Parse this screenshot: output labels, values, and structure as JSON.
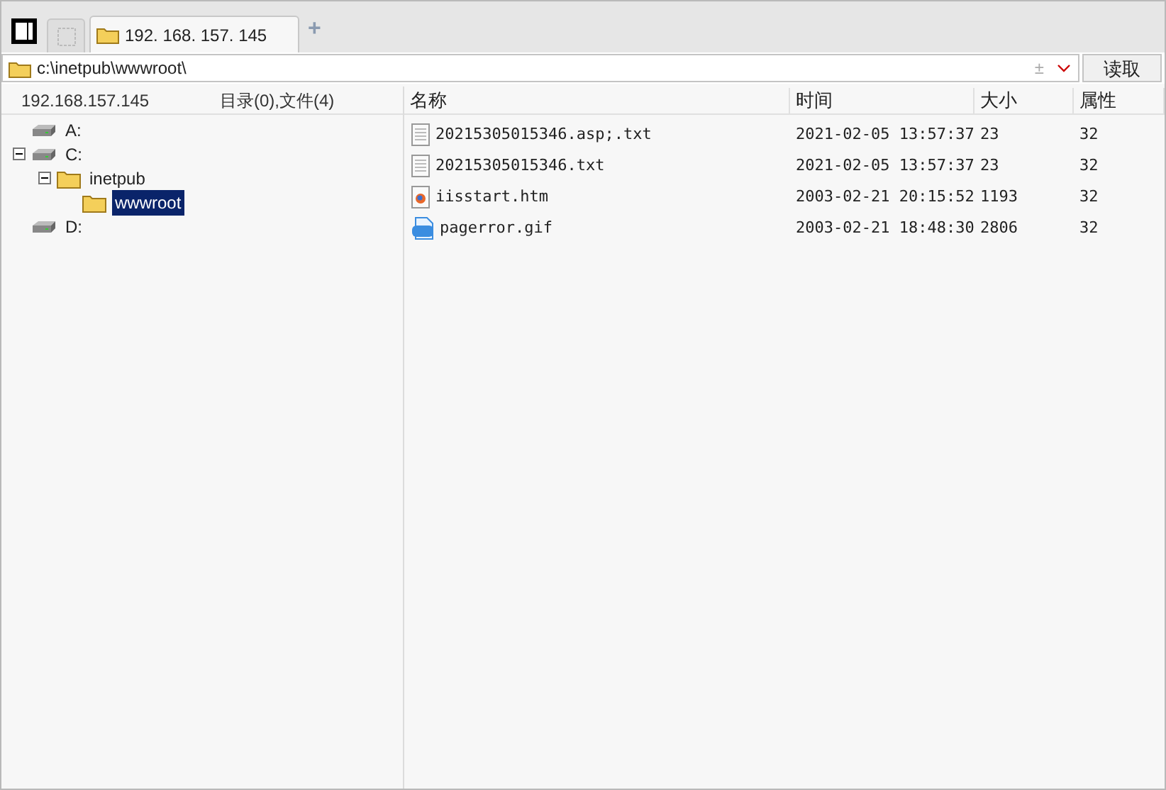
{
  "tabs": [
    {
      "label": "192. 168. 157. 145",
      "selected": true
    }
  ],
  "new_tab": "+",
  "address": {
    "value": "c:\\inetpub\\wwwroot\\",
    "sign": "±",
    "button": "读取"
  },
  "left_header": {
    "host": "192.168.157.145",
    "summary": "目录(0),文件(4)"
  },
  "tree": [
    {
      "label": "A:",
      "kind": "drive",
      "expanded": false,
      "selected": false
    },
    {
      "label": "C:",
      "kind": "drive",
      "expanded": true,
      "selected": false,
      "children": [
        {
          "label": "inetpub",
          "kind": "folder",
          "expanded": true,
          "selected": false,
          "children": [
            {
              "label": "wwwroot",
              "kind": "folder",
              "expanded": false,
              "selected": true
            }
          ]
        }
      ]
    },
    {
      "label": "D:",
      "kind": "drive",
      "expanded": false,
      "selected": false
    }
  ],
  "columns": [
    "名称",
    "时间",
    "大小",
    "属性"
  ],
  "files": [
    {
      "name": "20215305015346.asp;.txt",
      "kind": "text",
      "time": "2021-02-05 13:57:37",
      "size": "23",
      "attr": "32"
    },
    {
      "name": "20215305015346.txt",
      "kind": "text",
      "time": "2021-02-05 13:57:37",
      "size": "23",
      "attr": "32"
    },
    {
      "name": "iisstart.htm",
      "kind": "html",
      "time": "2003-02-21 20:15:52",
      "size": "1193",
      "attr": "32"
    },
    {
      "name": "pagerror.gif",
      "kind": "gif",
      "time": "2003-02-21 18:48:30",
      "size": "2806",
      "attr": "32"
    }
  ]
}
